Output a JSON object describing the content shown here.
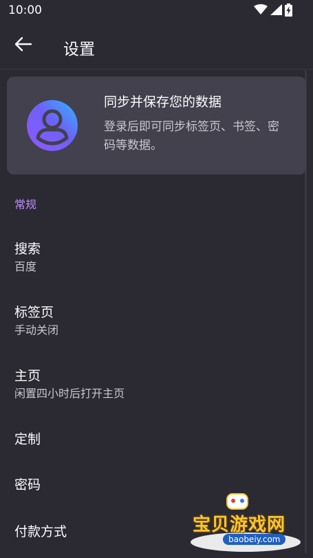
{
  "status_bar": {
    "time": "10:00",
    "icons": [
      "wifi-icon",
      "signal-icon",
      "battery-charging-icon"
    ]
  },
  "toolbar": {
    "back_icon": "arrow-left-icon",
    "title": "设置"
  },
  "sync_card": {
    "avatar_icon": "account-avatar-icon",
    "title": "同步并保存您的数据",
    "description": "登录后即可同步标签页、书签、密码等数据。"
  },
  "sections": {
    "general": {
      "header": "常规",
      "items": [
        {
          "title": "搜索",
          "subtitle": "百度"
        },
        {
          "title": "标签页",
          "subtitle": "手动关闭"
        },
        {
          "title": "主页",
          "subtitle": "闲置四小时后打开主页"
        },
        {
          "title": "定制"
        },
        {
          "title": "密码"
        },
        {
          "title": "付款方式"
        }
      ]
    }
  },
  "watermark": {
    "text": "宝贝游戏网",
    "url": "baobeiy.com"
  },
  "colors": {
    "background": "#2b2a33",
    "card": "#42414d",
    "accent": "#bf8fff",
    "primary_text": "#fbfbfe",
    "secondary_text": "#c9c8d0"
  }
}
